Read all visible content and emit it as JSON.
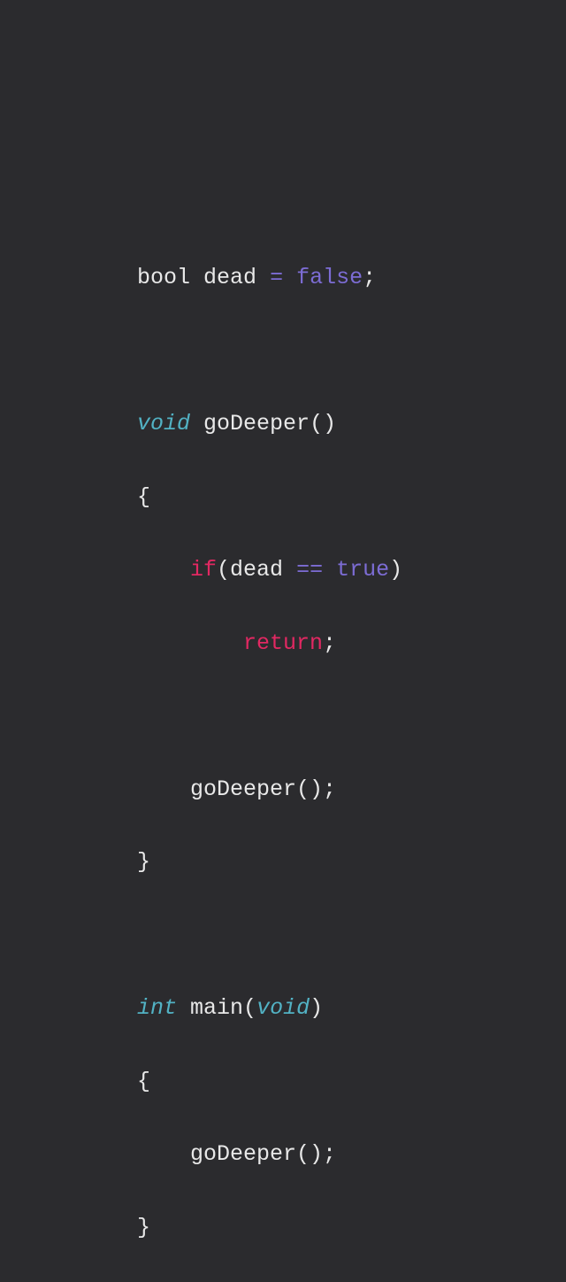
{
  "code": {
    "line1": {
      "type": "bool",
      "ident": "dead",
      "op": "=",
      "val": "false",
      "semi": ";"
    },
    "line3": {
      "type": "void",
      "ident": "goDeeper",
      "parens": "()"
    },
    "lbrace": "{",
    "line5": {
      "kw": "if",
      "open": "(",
      "ident": "dead",
      "op": "==",
      "val": "true",
      "close": ")"
    },
    "line6": {
      "ret": "return",
      "semi": ";"
    },
    "line8": {
      "ident": "goDeeper",
      "call": "();"
    },
    "rbrace": "}",
    "line11": {
      "type": "int",
      "ident": "main",
      "open": "(",
      "arg": "void",
      "close": ")"
    },
    "line13": {
      "ident": "goDeeper",
      "call": "();"
    }
  }
}
